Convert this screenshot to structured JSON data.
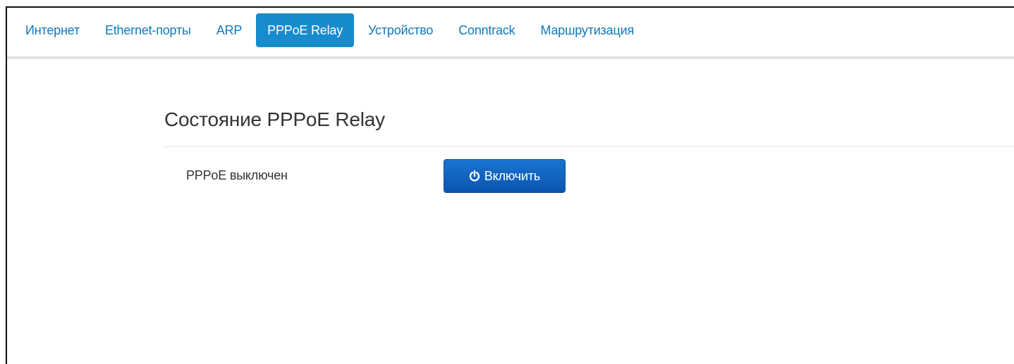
{
  "tabs": [
    {
      "label": "Интернет",
      "active": false
    },
    {
      "label": "Ethernet-порты",
      "active": false
    },
    {
      "label": "ARP",
      "active": false
    },
    {
      "label": "PPPoE Relay",
      "active": true
    },
    {
      "label": "Устройство",
      "active": false
    },
    {
      "label": "Conntrack",
      "active": false
    },
    {
      "label": "Маршрутизация",
      "active": false
    }
  ],
  "main": {
    "title": "Состояние PPPoE Relay",
    "status_label": "PPPoE выключен",
    "enable_button": {
      "label": "Включить",
      "icon": "power-icon"
    }
  },
  "colors": {
    "accent": "#168ccc",
    "link": "#1178bd",
    "button": "#0a56b0"
  }
}
